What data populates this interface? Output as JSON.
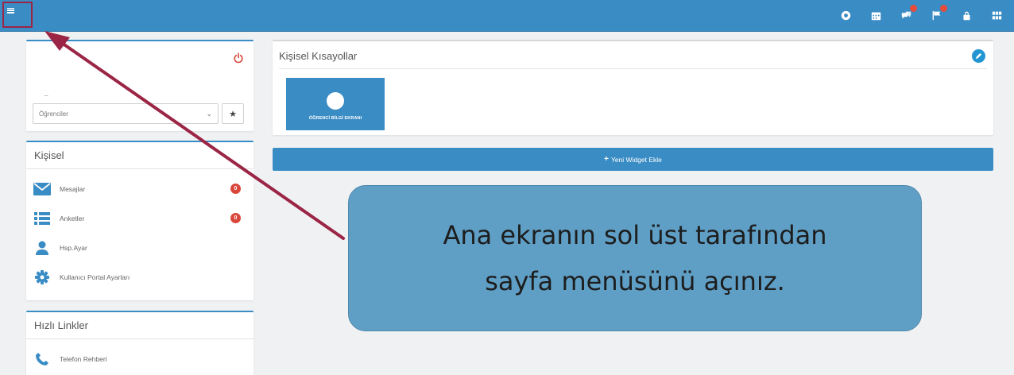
{
  "topbar": {
    "icons": [
      "globe-icon",
      "calendar-icon",
      "chat-icon",
      "flag-icon",
      "lock-icon",
      "grid-icon"
    ]
  },
  "profile": {
    "dash": "_",
    "select_value": "Öğrenciler"
  },
  "personal": {
    "title": "Kişisel",
    "items": [
      {
        "label": "Mesajlar",
        "badge": "0",
        "icon": "envelope-icon"
      },
      {
        "label": "Anketler",
        "badge": "0",
        "icon": "list-icon"
      },
      {
        "label": "Hsp.Ayar",
        "icon": "user-icon"
      },
      {
        "label": "Kullanıcı Portal Ayarları",
        "icon": "gear-icon"
      }
    ]
  },
  "quick_links": {
    "title": "Hızlı Linkler",
    "items": [
      {
        "label": "Telefon Rehberi",
        "icon": "phone-icon"
      }
    ]
  },
  "shortcuts": {
    "title": "Kişisel Kısayollar",
    "tile_label": "ÖĞRENCİ BİLGİ EKRANI"
  },
  "add_widget_label": "Yeni Widget Ekle",
  "callout": {
    "line1": "Ana ekranın sol üst tarafından",
    "line2": "sayfa menüsünü açınız."
  },
  "colors": {
    "primary": "#3a8cc4",
    "badge": "#d9473b",
    "annotation": "#9b2545",
    "callout_bg": "#5f9fc6"
  }
}
